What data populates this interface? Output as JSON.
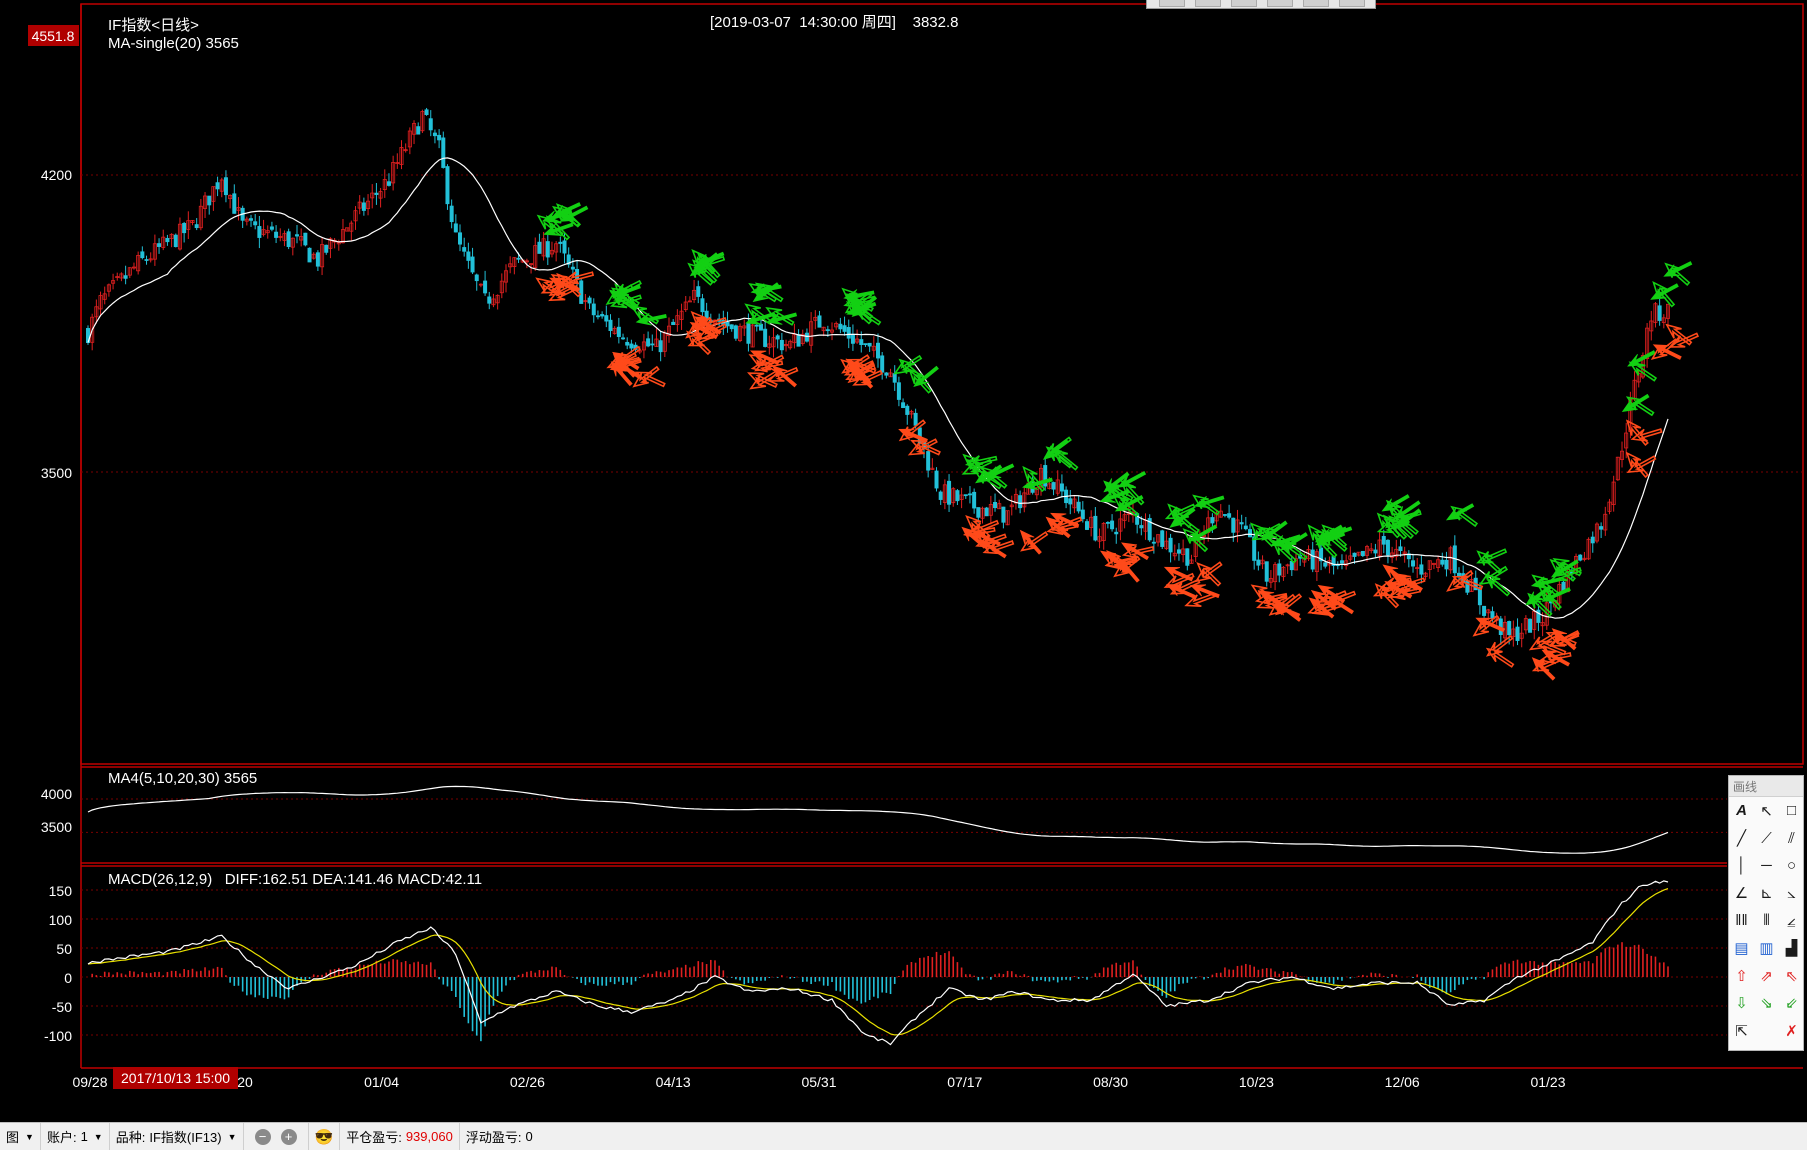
{
  "header": {
    "instrument_title": "IF指数<日线>",
    "ma_label": "MA-single(20)  3565",
    "cursor_info": "[2019-03-07  14:30:00 周四]    3832.8",
    "top_price_badge": "4551.8"
  },
  "main_panel": {
    "y_ticks": [
      "4200",
      "3500"
    ],
    "y_tick_values": [
      4200,
      3500
    ],
    "ylim": [
      2800,
      4600
    ]
  },
  "ma4_panel": {
    "label": "MA4(5,10,20,30)  3565",
    "y_ticks": [
      "4000",
      "3500"
    ],
    "y_tick_values": [
      4000,
      3500
    ]
  },
  "macd_panel": {
    "label": "MACD(26,12,9)   DIFF:162.51 DEA:141.46 MACD:42.11",
    "y_ticks": [
      "150",
      "100",
      "50",
      "0",
      "-50",
      "-100"
    ],
    "y_tick_values": [
      150,
      100,
      50,
      0,
      -50,
      -100
    ]
  },
  "x_axis": {
    "labels": [
      "09/28",
      "11/20",
      "01/04",
      "02/26",
      "04/13",
      "05/31",
      "07/17",
      "08/30",
      "10/23",
      "12/06",
      "01/23"
    ],
    "cursor_time_badge": "2017/10/13 15:00"
  },
  "chart_data": {
    "type": "candlestick",
    "x_range": [
      "2017-09-28",
      "2019-03-07"
    ],
    "price_anchors": [
      [
        0,
        3830
      ],
      [
        3,
        3900
      ],
      [
        12,
        3990
      ],
      [
        25,
        4080
      ],
      [
        32,
        4200
      ],
      [
        37,
        4080
      ],
      [
        50,
        4040
      ],
      [
        55,
        4000
      ],
      [
        62,
        4080
      ],
      [
        72,
        4190
      ],
      [
        80,
        4340
      ],
      [
        84,
        4260
      ],
      [
        88,
        4050
      ],
      [
        92,
        3960
      ],
      [
        95,
        3900
      ],
      [
        102,
        3990
      ],
      [
        112,
        4040
      ],
      [
        120,
        3880
      ],
      [
        128,
        3820
      ],
      [
        136,
        3790
      ],
      [
        145,
        3910
      ],
      [
        152,
        3850
      ],
      [
        160,
        3820
      ],
      [
        168,
        3800
      ],
      [
        176,
        3860
      ],
      [
        184,
        3810
      ],
      [
        192,
        3740
      ],
      [
        198,
        3600
      ],
      [
        204,
        3450
      ],
      [
        212,
        3420
      ],
      [
        220,
        3400
      ],
      [
        228,
        3500
      ],
      [
        234,
        3440
      ],
      [
        242,
        3350
      ],
      [
        250,
        3400
      ],
      [
        258,
        3330
      ],
      [
        264,
        3300
      ],
      [
        270,
        3420
      ],
      [
        276,
        3360
      ],
      [
        282,
        3250
      ],
      [
        290,
        3300
      ],
      [
        300,
        3270
      ],
      [
        310,
        3330
      ],
      [
        318,
        3270
      ],
      [
        326,
        3300
      ],
      [
        334,
        3180
      ],
      [
        340,
        3110
      ],
      [
        348,
        3160
      ],
      [
        356,
        3290
      ],
      [
        362,
        3380
      ],
      [
        366,
        3520
      ],
      [
        370,
        3700
      ],
      [
        374,
        3870
      ],
      [
        378,
        3880
      ]
    ],
    "ma20_label_value": 3565,
    "macd_anchors": [
      [
        0,
        25
      ],
      [
        10,
        35
      ],
      [
        20,
        45
      ],
      [
        32,
        70
      ],
      [
        40,
        20
      ],
      [
        48,
        -20
      ],
      [
        56,
        0
      ],
      [
        64,
        20
      ],
      [
        74,
        60
      ],
      [
        82,
        85
      ],
      [
        88,
        40
      ],
      [
        94,
        -80
      ],
      [
        100,
        -55
      ],
      [
        112,
        -25
      ],
      [
        122,
        -50
      ],
      [
        130,
        -60
      ],
      [
        140,
        -40
      ],
      [
        150,
        0
      ],
      [
        158,
        -25
      ],
      [
        168,
        -20
      ],
      [
        178,
        -40
      ],
      [
        186,
        -100
      ],
      [
        192,
        -115
      ],
      [
        198,
        -70
      ],
      [
        206,
        -20
      ],
      [
        214,
        -40
      ],
      [
        222,
        -25
      ],
      [
        230,
        -40
      ],
      [
        240,
        -40
      ],
      [
        250,
        5
      ],
      [
        258,
        -50
      ],
      [
        268,
        -40
      ],
      [
        278,
        -10
      ],
      [
        288,
        0
      ],
      [
        298,
        -20
      ],
      [
        308,
        -10
      ],
      [
        318,
        -10
      ],
      [
        326,
        -50
      ],
      [
        334,
        -40
      ],
      [
        342,
        0
      ],
      [
        352,
        30
      ],
      [
        360,
        60
      ],
      [
        366,
        120
      ],
      [
        372,
        160
      ],
      [
        378,
        165
      ]
    ],
    "diff_last": 162.51,
    "dea_last": 141.46,
    "macd_last": 42.11
  },
  "status_bar": {
    "chart_menu": "图",
    "account_label": "账户:",
    "account_value": "1",
    "symbol_label": "品种:",
    "symbol_value": "IF指数(IF13)",
    "closed_pl_label": "平仓盈亏:",
    "closed_pl_value": "939,060",
    "floating_pl_label": "浮动盈亏:",
    "floating_pl_value": "0"
  },
  "draw_panel": {
    "title": "画线"
  },
  "colors": {
    "up": "#e02020",
    "down": "#22c0d8",
    "ma": "#ffffff",
    "dea": "#e8e000",
    "grid": "#7a0000",
    "frame": "#c00000",
    "buy_arrow": "#ff4a1a",
    "sell_arrow": "#13d013"
  }
}
